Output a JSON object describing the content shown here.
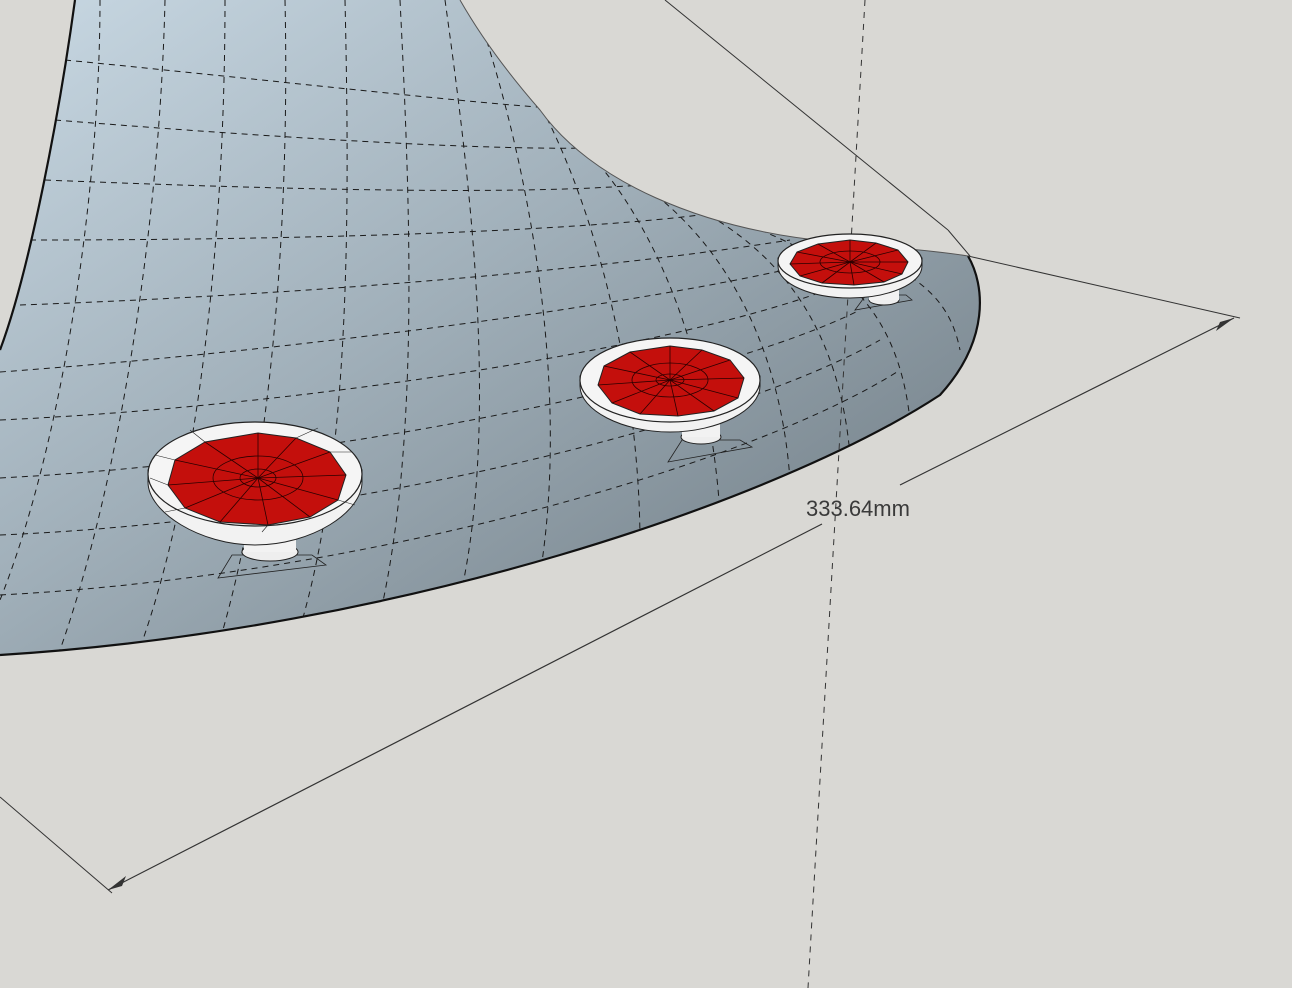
{
  "viewport": {
    "background_color": "#d9d8d4"
  },
  "model": {
    "surface_light_color": "#c4d3dd",
    "surface_dark_color": "#6f7b83",
    "grid_line_color": "#111111",
    "button_cap_color": "#c8100c",
    "button_rim_color": "#f2f2f2"
  },
  "dimension": {
    "label": "333.64mm",
    "line_color": "#333333"
  }
}
